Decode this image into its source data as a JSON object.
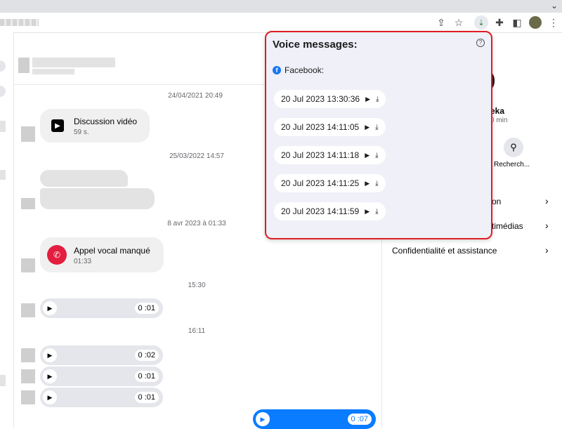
{
  "popup": {
    "title": "Voice messages:",
    "source": "Facebook:",
    "messages": [
      {
        "label": "20 Jul 2023 13:30:36"
      },
      {
        "label": "20 Jul 2023 14:11:05"
      },
      {
        "label": "20 Jul 2023 14:11:18"
      },
      {
        "label": "20 Jul 2023 14:11:25"
      },
      {
        "label": "20 Jul 2023 14:11:59"
      }
    ]
  },
  "chat": {
    "timestamps": [
      "24/04/2021 20:49",
      "25/03/2022 14:57",
      "8 avr 2023 à 01:33",
      "15:30",
      "16:11"
    ],
    "video_call": {
      "title": "Discussion vidéo",
      "duration": "59 s."
    },
    "missed_call": {
      "title": "Appel vocal manqué",
      "time": "01:33"
    },
    "audio": [
      {
        "duration": "0 :01"
      },
      {
        "duration": "0 :02"
      },
      {
        "duration": "0 :01"
      },
      {
        "duration": "0 :01"
      },
      {
        "duration": "0 :07"
      }
    ]
  },
  "right_panel": {
    "name_fragment": "eka",
    "status_fragment": "0 min",
    "search_label": "Recherch...",
    "menu": [
      {
        "label": "on"
      },
      {
        "label": "timédias"
      },
      {
        "label": "Confidentialité et assistance"
      }
    ]
  },
  "colors": {
    "popup_border": "#e11c24",
    "popup_bg": "#eff0f8",
    "messenger_blue": "#0a7cff",
    "missed_red": "#e41e3f",
    "facebook_blue": "#1877f2"
  },
  "icons": [
    "share-icon",
    "star-icon",
    "extension-active-icon",
    "puzzle-icon",
    "sidepanel-icon",
    "profile-avatar",
    "more-vert-icon",
    "help-icon",
    "facebook-icon",
    "play-icon",
    "download-icon",
    "video-call-icon",
    "missed-call-icon",
    "search-icon",
    "chevron-right-icon"
  ]
}
